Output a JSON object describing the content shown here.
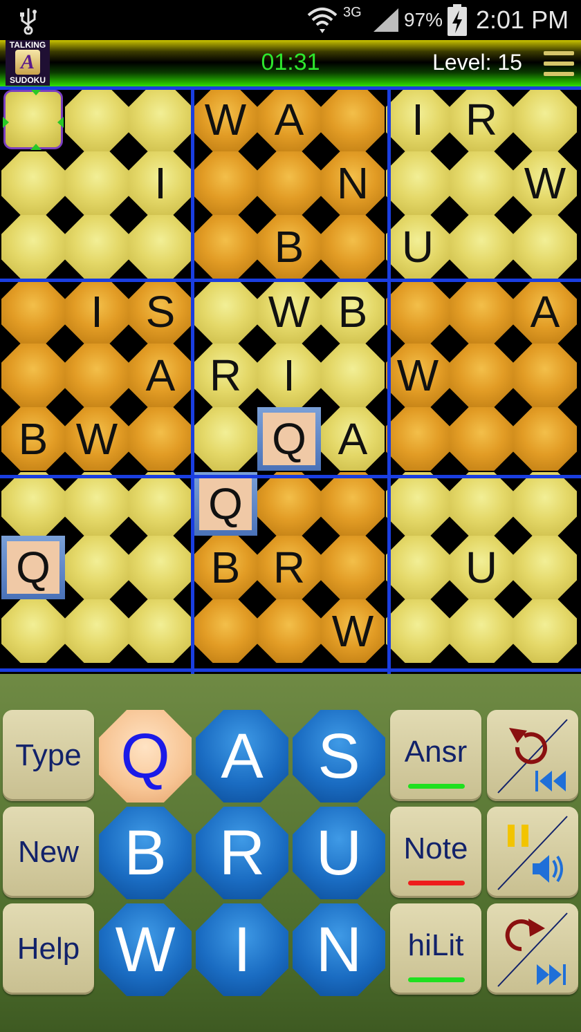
{
  "status_bar": {
    "network": "3G",
    "battery": "97%",
    "time": "2:01 PM"
  },
  "header": {
    "logo_top": "TALKING",
    "logo_letter": "A",
    "logo_bottom": "SUDOKU",
    "timer": "01:31",
    "level": "Level: 15"
  },
  "board": {
    "rows": [
      [
        "",
        "",
        "",
        "W",
        "A",
        "",
        "I",
        "R",
        ""
      ],
      [
        "",
        "",
        "I",
        "",
        "",
        "N",
        "",
        "",
        "W"
      ],
      [
        "",
        "",
        "",
        "",
        "B",
        "",
        "U",
        "",
        ""
      ],
      [
        "",
        "I",
        "S",
        "",
        "W",
        "B",
        "",
        "",
        "A"
      ],
      [
        "",
        "",
        "A",
        "R",
        "I",
        "",
        "W",
        "",
        ""
      ],
      [
        "B",
        "W",
        "",
        "",
        "Q",
        "A",
        "",
        "",
        ""
      ],
      [
        "",
        "",
        "",
        "Q",
        "",
        "",
        "",
        "",
        ""
      ],
      [
        "Q",
        "",
        "",
        "B",
        "R",
        "",
        "",
        "U",
        ""
      ],
      [
        "",
        "",
        "",
        "",
        "",
        "W",
        "",
        "",
        ""
      ]
    ],
    "given_cells": [
      [
        5,
        4
      ],
      [
        6,
        3
      ],
      [
        7,
        0
      ]
    ],
    "selected_cell": [
      0,
      0
    ]
  },
  "controls": {
    "left_buttons": [
      "Type",
      "New",
      "Help"
    ],
    "keys": [
      [
        "Q",
        "A",
        "S"
      ],
      [
        "B",
        "R",
        "U"
      ],
      [
        "W",
        "I",
        "N"
      ]
    ],
    "active_key": "Q",
    "mode_buttons": [
      {
        "label": "Ansr",
        "underline_color": "#1fe01f"
      },
      {
        "label": "Note",
        "underline_color": "#ee1c1c"
      },
      {
        "label": "hiLit",
        "underline_color": "#1fe01f"
      }
    ],
    "right_icons": [
      "undo-rewind-icon",
      "pause-sound-icon",
      "redo-forward-icon"
    ]
  }
}
